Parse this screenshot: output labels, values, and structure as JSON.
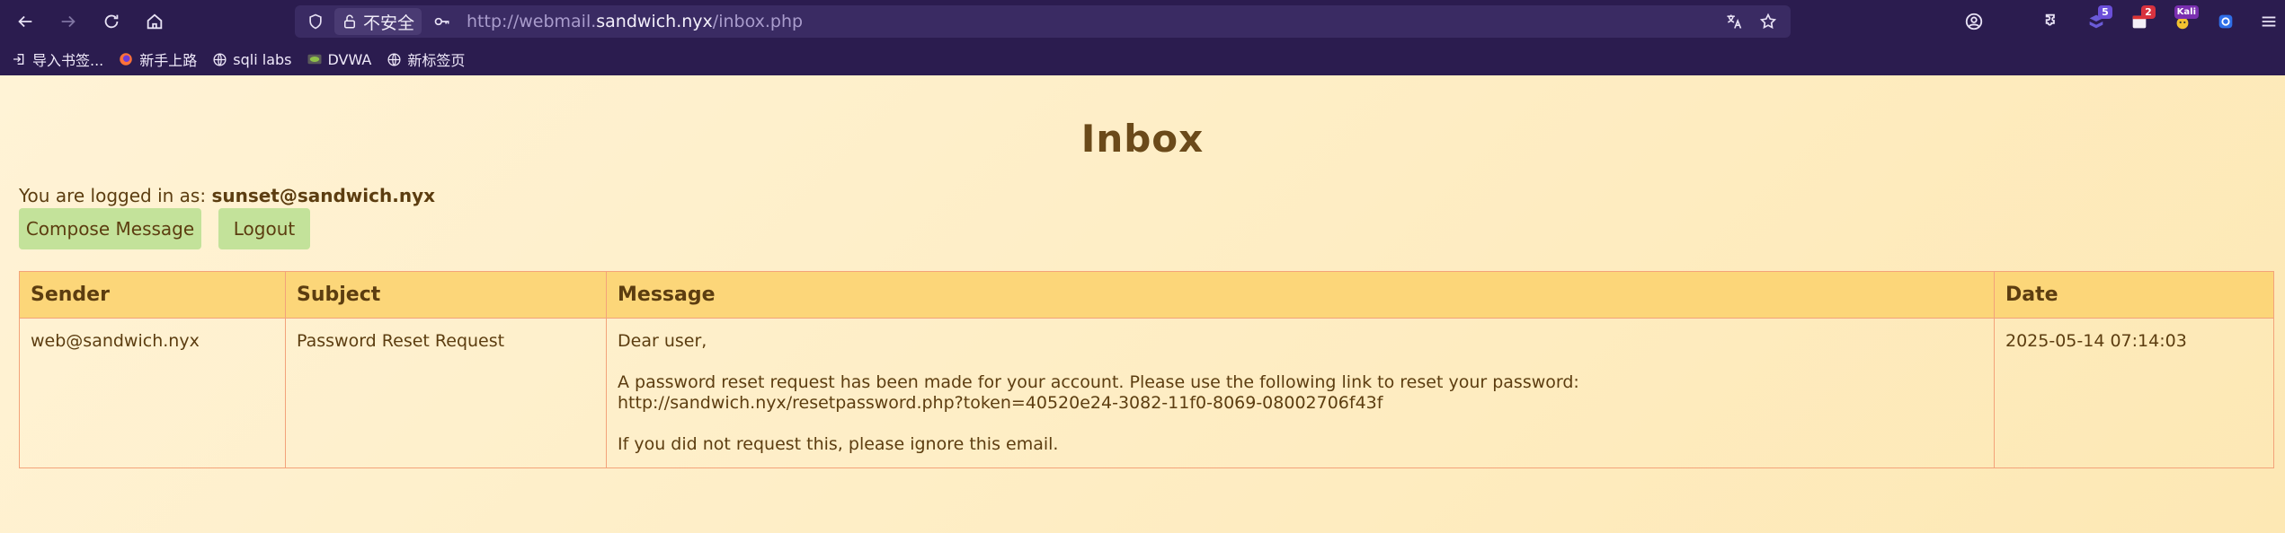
{
  "browser": {
    "security_label": "不安全",
    "url_scheme": "http://webmail.",
    "url_host": "sandwich.nyx",
    "url_path": "/inbox.php",
    "extension_badges": [
      "5",
      "2",
      "Kali"
    ]
  },
  "bookmarks": [
    {
      "label": "导入书签...",
      "icon": "import-icon"
    },
    {
      "label": "新手上路",
      "icon": "firefox-icon"
    },
    {
      "label": "sqli labs",
      "icon": "globe-icon"
    },
    {
      "label": "DVWA",
      "icon": "dvwa-icon"
    },
    {
      "label": "新标签页",
      "icon": "globe-icon"
    }
  ],
  "page": {
    "title": "Inbox",
    "logged_prefix": "You are logged in as: ",
    "logged_user": "sunset@sandwich.nyx",
    "compose_label": "Compose Message",
    "logout_label": "Logout"
  },
  "table": {
    "headers": [
      "Sender",
      "Subject",
      "Message",
      "Date"
    ],
    "rows": [
      {
        "sender": "web@sandwich.nyx",
        "subject": "Password Reset Request",
        "message_lines": [
          "Dear user,",
          "",
          "A password reset request has been made for your account. Please use the following link to reset your password:",
          "http://sandwich.nyx/resetpassword.php?token=40520e24-3082-11f0-8069-08002706f43f",
          "",
          "If you did not request this, please ignore this email."
        ],
        "date": "2025-05-14 07:14:03"
      }
    ]
  },
  "colors": {
    "chrome_bg": "#2b1c4f",
    "page_text": "#5c3d10",
    "title_text": "#6b4a1a",
    "button_bg": "#c3e29a",
    "table_header_bg": "#fcd679",
    "table_border": "#f3a37a"
  }
}
